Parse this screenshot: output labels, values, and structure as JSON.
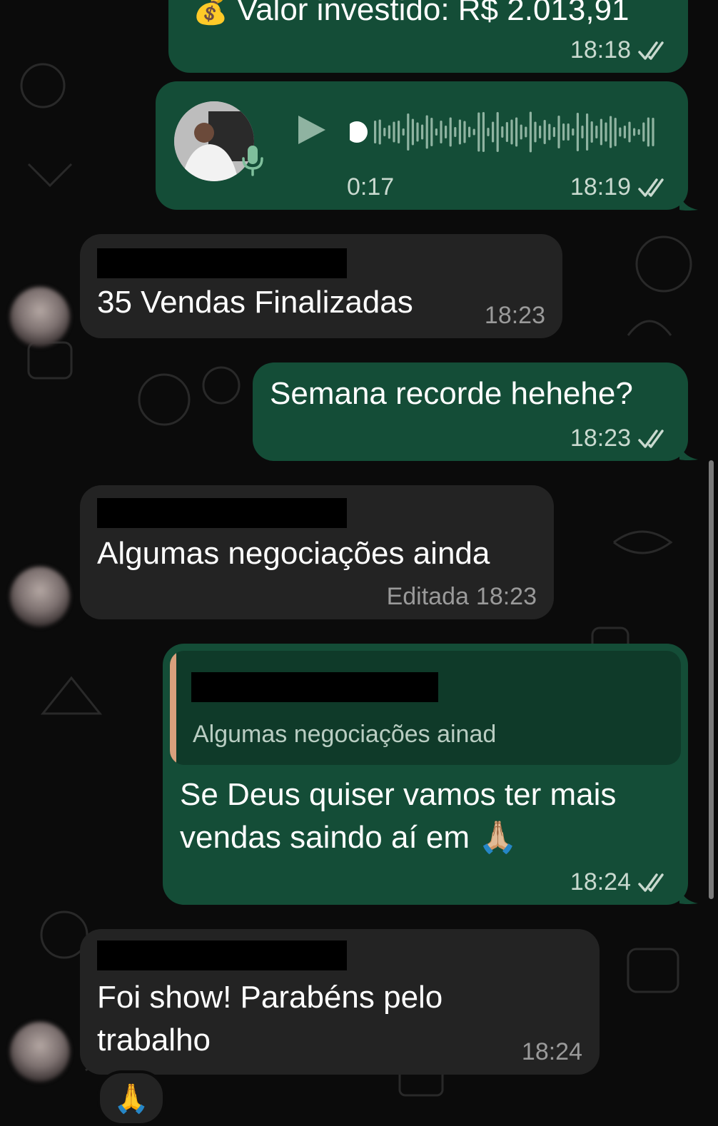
{
  "messages": {
    "m1": {
      "text": "Valor investido: R$ 2.013,91",
      "time": "18:18",
      "icon": "money-bag-icon"
    },
    "m2": {
      "duration": "0:17",
      "time": "18:19",
      "icon": "play-icon"
    },
    "m3": {
      "text": "35 Vendas Finalizadas",
      "time": "18:23"
    },
    "m4": {
      "text": "Semana recorde hehehe?",
      "time": "18:23"
    },
    "m5": {
      "text": "Algumas negociações ainda",
      "edited": "Editada",
      "time": "18:23"
    },
    "m6": {
      "quote_text": "Algumas negociações ainad",
      "line1": "Se Deus quiser vamos ter mais",
      "line2": "vendas saindo aí em 🙏🏼",
      "time": "18:24"
    },
    "m7": {
      "line1": "Foi show! Parabéns pelo",
      "line2": "trabalho",
      "time": "18:24",
      "reaction": "🙏"
    }
  },
  "colors": {
    "outgoing": "#144d37",
    "incoming": "#232323",
    "background": "#0b0b0b",
    "quote_bar": "#d9a07c"
  }
}
